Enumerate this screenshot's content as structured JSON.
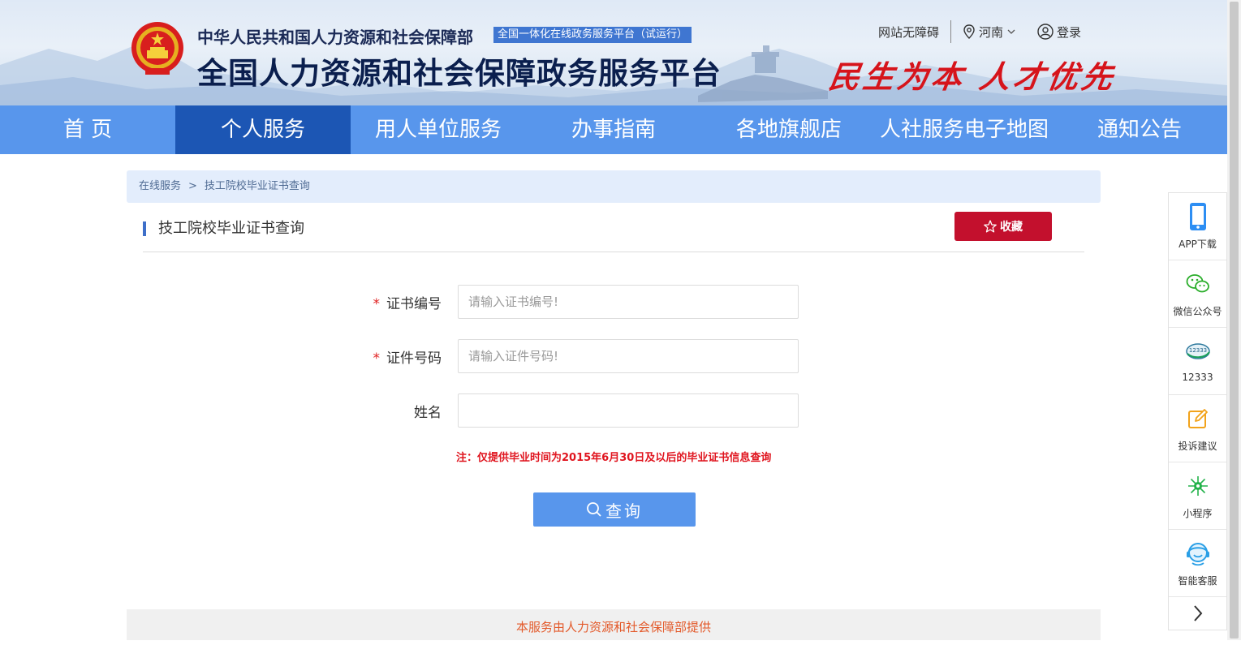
{
  "header": {
    "ministry": "中华人民共和国人力资源和社会保障部",
    "trial_badge": "全国一体化在线政务服务平台（试运行）",
    "platform_title": "全国人力资源和社会保障政务服务平台",
    "slogan": "民生为本 人才优先",
    "accessibility_link": "网站无障碍",
    "region": "河南",
    "login": "登录"
  },
  "nav": {
    "items": [
      {
        "label": "首 页"
      },
      {
        "label": "个人服务"
      },
      {
        "label": "用人单位服务"
      },
      {
        "label": "办事指南"
      },
      {
        "label": "各地旗舰店"
      },
      {
        "label": "人社服务电子地图"
      },
      {
        "label": "通知公告"
      }
    ],
    "active_index": 1
  },
  "breadcrumb": {
    "items": [
      "在线服务",
      "技工院校毕业证书查询"
    ],
    "separator": ">"
  },
  "page": {
    "title": "技工院校毕业证书查询",
    "favorite_label": "收藏"
  },
  "form": {
    "certificate_number": {
      "label": "证书编号",
      "required_mark": "*",
      "placeholder": "请输入证书编号!",
      "value": ""
    },
    "id_number": {
      "label": "证件号码",
      "required_mark": "*",
      "placeholder": "请输入证件号码!",
      "value": ""
    },
    "name": {
      "label": "姓名",
      "value": ""
    },
    "note": "注：仅提供毕业时间为2015年6月30日及以后的毕业证书信息查询",
    "submit_label": "查询"
  },
  "footer": {
    "text": "本服务由人力资源和社会保障部提供"
  },
  "side_toolbar": {
    "items": [
      {
        "label": "APP下载",
        "icon": "phone-icon"
      },
      {
        "label": "微信公众号",
        "icon": "wechat-icon"
      },
      {
        "label": "12333",
        "icon": "hotline-12333-icon"
      },
      {
        "label": "投诉建议",
        "icon": "edit-icon"
      },
      {
        "label": "小程序",
        "icon": "mini-program-icon"
      },
      {
        "label": "智能客服",
        "icon": "customer-service-icon"
      }
    ]
  },
  "colors": {
    "nav_bg": "#5896ec",
    "nav_active": "#1c56b4",
    "favorite_btn": "#c3102d",
    "note_red": "#e0151f",
    "slogan_red": "#d6141b"
  }
}
